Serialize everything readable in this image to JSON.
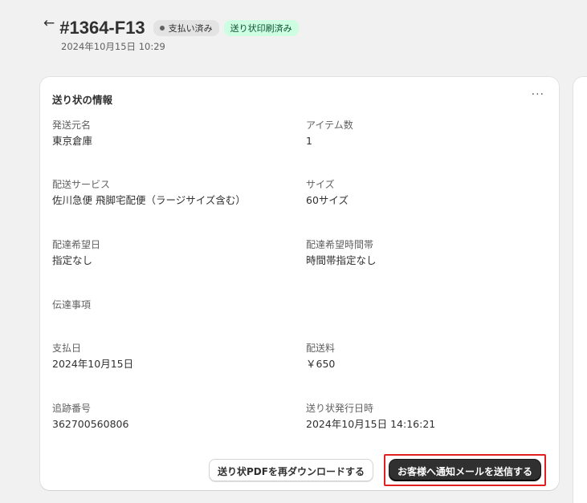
{
  "header": {
    "back_icon": "arrow-left-icon",
    "order_number": "#1364-F13",
    "badge_paid": "支払い済み",
    "badge_printed": "送り状印刷済み",
    "date": "2024年10月15日 10:29"
  },
  "card": {
    "title": "送り状の情報",
    "more_icon": "···",
    "fields": {
      "sender": {
        "label": "発送元名",
        "value": "東京倉庫"
      },
      "item_count": {
        "label": "アイテム数",
        "value": "1"
      },
      "service": {
        "label": "配送サービス",
        "value": "佐川急便 飛脚宅配便（ラージサイズ含む）"
      },
      "size": {
        "label": "サイズ",
        "value": "60サイズ"
      },
      "delivery_date": {
        "label": "配達希望日",
        "value": "指定なし"
      },
      "delivery_time": {
        "label": "配達希望時間帯",
        "value": "時間帯指定なし"
      },
      "notes": {
        "label": "伝達事項",
        "value": ""
      },
      "payment_date": {
        "label": "支払日",
        "value": "2024年10月15日"
      },
      "shipping_fee": {
        "label": "配送料",
        "value": "￥650"
      },
      "tracking": {
        "label": "追跡番号",
        "value": "362700560806"
      },
      "issued_at": {
        "label": "送り状発行日時",
        "value": "2024年10月15日 14:16:21"
      }
    },
    "buttons": {
      "download": "送り状PDFを再ダウンロードする",
      "notify": "お客様へ通知メールを送信する"
    }
  },
  "colors": {
    "background": "#f1f1f1",
    "badge_printed_bg": "#cdfee1",
    "primary_button": "#303030",
    "highlight": "#e02020"
  }
}
